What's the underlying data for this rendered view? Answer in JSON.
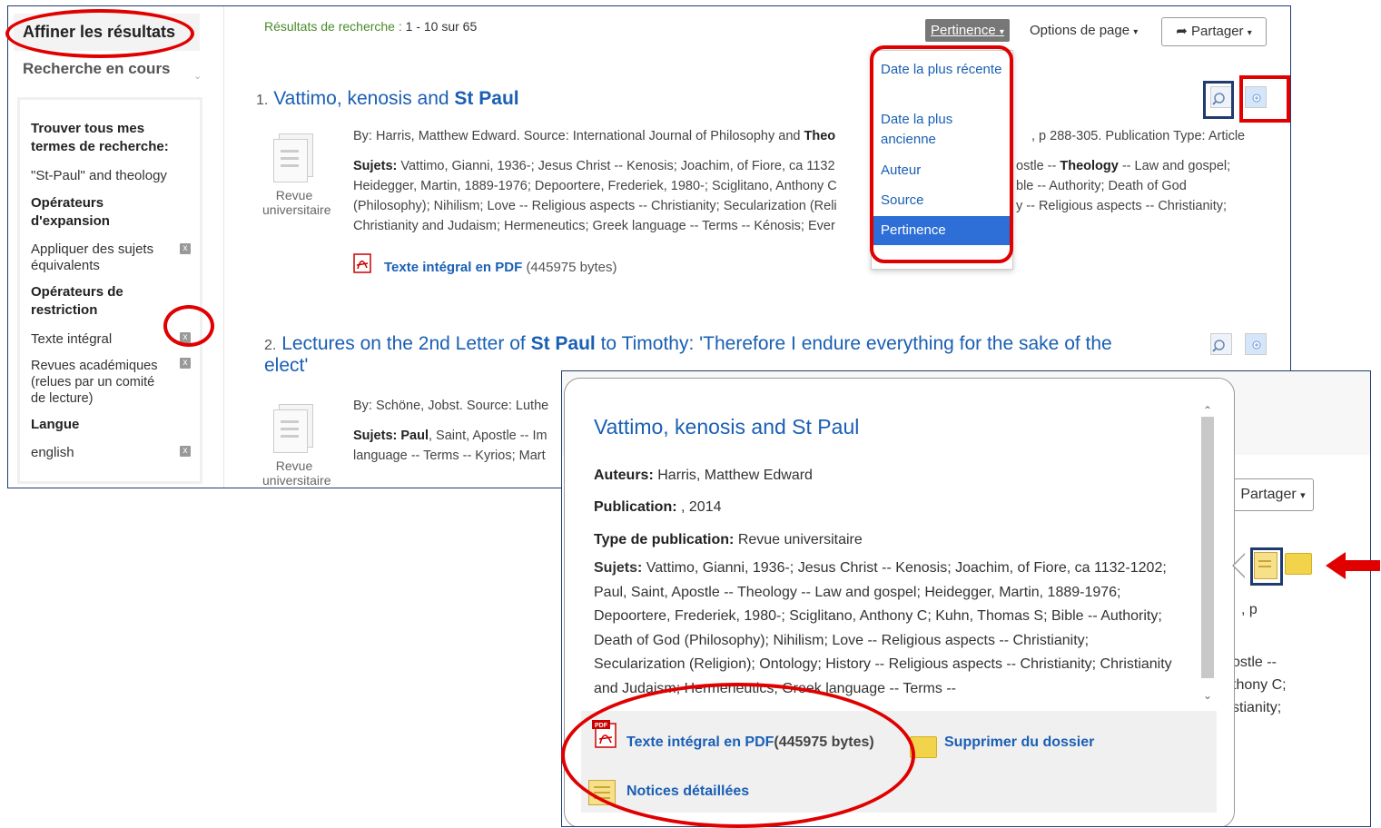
{
  "sidebar": {
    "title": "Affiner les résultats",
    "current_search": "Recherche en cours",
    "find_all_heading": "Trouver tous mes termes de recherche:",
    "search_term": "\"St-Paul\" and theology",
    "expanders_heading": "Opérateurs d'expansion",
    "expander_item": "Appliquer des sujets équivalents",
    "limiters_heading": "Opérateurs de restriction",
    "limiter_fulltext": "Texte intégral",
    "limiter_academic": "Revues académiques (relues par un comité de lecture)",
    "language_heading": "Langue",
    "language_value": "english",
    "remove_glyph": "x"
  },
  "toolbar": {
    "results_label": "Résultats de recherche :",
    "results_count": "1 - 10 sur 65",
    "sort_label": "Pertinence",
    "page_options": "Options de page",
    "share": "Partager"
  },
  "sort_menu": [
    {
      "label": "Date la plus récente",
      "active": false
    },
    {
      "label": "Date la plus ancienne",
      "active": false
    },
    {
      "label": "Auteur",
      "active": false
    },
    {
      "label": "Source",
      "active": false
    },
    {
      "label": "Pertinence",
      "active": true
    }
  ],
  "results": [
    {
      "number": "1.",
      "title_pre": "Vattimo, kenosis and",
      "title_bold": "St Paul",
      "title_post": "",
      "doc_type": "Revue universitaire",
      "byline_pre": "By: Harris, Matthew Edward. Source: International Journal of Philosophy and",
      "byline_bold": "Theo",
      "byline_post": ", p 288-305. Publication Type: Article",
      "subjects_label": "Sujets:",
      "subjects_l1_pre": "Vattimo, Gianni, 1936-; Jesus Christ -- Kenosis; Joachim, of Fiore, ca 1132",
      "subjects_l1_post_a": "ostle --",
      "subjects_l1_bold": "Theology",
      "subjects_l1_post_b": "-- Law and gospel;",
      "subjects_l2_pre": "Heidegger, Martin, 1889-1976; Depoortere, Frederiek, 1980-; Sciglitano, Anthony C",
      "subjects_l2_post": "ble -- Authority; Death of God",
      "subjects_l3_pre": "(Philosophy); Nihilism; Love -- Religious aspects -- Christianity; Secularization (Reli",
      "subjects_l3_post": "y -- Religious aspects -- Christianity;",
      "subjects_l4": "Christianity and Judaism; Hermeneutics; Greek language -- Terms -- Kénosis; Ever",
      "pdf_link": "Texte intégral en PDF",
      "pdf_size": "(445975 bytes)"
    },
    {
      "number": "2.",
      "title_pre": "Lectures on the 2nd Letter of",
      "title_bold": "St Paul",
      "title_post": "to Timothy: 'Therefore I endure everything for the sake of the",
      "title_line2": "elect'",
      "doc_type": "Revue universitaire",
      "byline": "By: Schöne, Jobst. Source: Luthe",
      "subjects_label": "Sujets:",
      "subjects_bold": "Paul",
      "subjects_l1_rest": ", Saint, Apostle -- Im",
      "subjects_l2": "language -- Terms -- Kyrios; Mart"
    }
  ],
  "popup": {
    "title": "Vattimo, kenosis and St Paul",
    "authors_label": "Auteurs:",
    "authors": "Harris, Matthew Edward",
    "publication_label": "Publication:",
    "publication": ", 2014",
    "type_label": "Type de publication:",
    "type": "Revue universitaire",
    "subjects_label": "Sujets:",
    "subjects": "Vattimo, Gianni, 1936-; Jesus Christ -- Kenosis; Joachim, of Fiore, ca 1132-1202; Paul, Saint, Apostle -- Theology -- Law and gospel; Heidegger, Martin, 1889-1976; Depoortere, Frederiek, 1980-; Sciglitano, Anthony C; Kuhn, Thomas S; Bible -- Authority; Death of God (Philosophy); Nihilism; Love -- Religious aspects -- Christianity; Secularization (Religion); Ontology; History -- Religious aspects -- Christianity; Christianity and Judaism; Hermeneutics; Greek language -- Terms --",
    "pdf_link": "Texte intégral en PDF",
    "pdf_size": "(445975 bytes)",
    "remove_folder": "Supprimer du dossier",
    "detailed": "Notices détaillées",
    "pdf_badge": "PDF"
  },
  "popup_background": {
    "share": "Partager",
    "frag_p": ", p",
    "frag_ostle": "ostle --",
    "frag_thony": "thony C;",
    "frag_stianity": "stianity;"
  },
  "colors": {
    "link": "#1a5fb4",
    "annotation_red": "#e00000",
    "highlight_navy": "#1f3b70",
    "active_sort": "#2d6fd6"
  }
}
